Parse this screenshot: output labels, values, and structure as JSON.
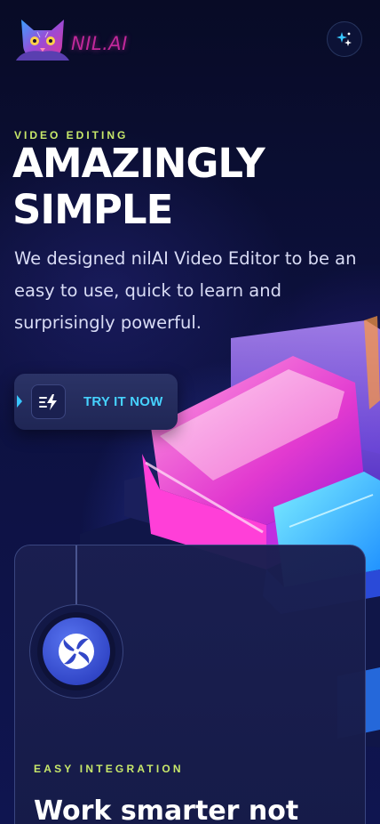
{
  "header": {
    "brand": "NIL.AI",
    "logo_icon": "cat-logo-icon",
    "sparkle_icon": "sparkle-icon"
  },
  "hero": {
    "eyebrow": "VIDEO EDITING",
    "headline": "AMAZINGLY SIMPLE",
    "description": "We designed nilAI Video Editor to be an easy to use, quick to learn and surprisingly powerful.",
    "cta": {
      "label": "TRY IT NOW",
      "icon": "lightning-list-icon"
    }
  },
  "feature_card": {
    "icon": "aperture-swirl-icon",
    "eyebrow": "EASY INTEGRATION",
    "title": "Work smarter not"
  },
  "colors": {
    "background": "#0b0f33",
    "accent_lime": "#c8e86a",
    "accent_cyan": "#46d2ff",
    "brand_magenta": "#c0289a",
    "badge_blue": "#3247c8"
  }
}
